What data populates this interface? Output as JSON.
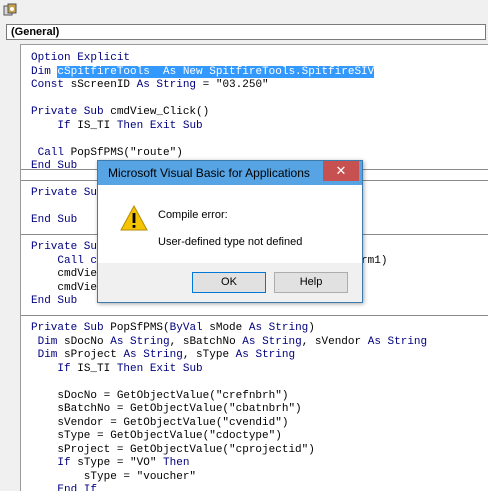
{
  "object_combo": {
    "value": "(General)"
  },
  "code": [
    [
      {
        "t": "Option Explicit",
        "c": "kw"
      }
    ],
    [
      {
        "t": "Dim ",
        "c": "kw"
      },
      {
        "t": "cSpitfireTools  As New SpitfireTools.SpitfireSIV",
        "c": "sel"
      }
    ],
    [
      {
        "t": "Const ",
        "c": "kw"
      },
      {
        "t": "sScreenID "
      },
      {
        "t": "As String",
        "c": "kw"
      },
      {
        "t": " = \"03.250\""
      }
    ],
    [],
    [
      {
        "t": "Private Sub ",
        "c": "kw"
      },
      {
        "t": "cmdView_Click()"
      }
    ],
    [
      {
        "t": "    If ",
        "c": "kw"
      },
      {
        "t": "IS_TI "
      },
      {
        "t": "Then Exit Sub",
        "c": "kw"
      }
    ],
    [],
    [
      {
        "t": " Call ",
        "c": "kw"
      },
      {
        "t": "PopSfPMS(\"route\")"
      }
    ],
    [
      {
        "t": "End Sub",
        "c": "kw"
      }
    ],
    [],
    [
      {
        "t": "Private Su",
        "c": "kw"
      }
    ],
    [],
    [
      {
        "t": "End Sub",
        "c": "kw"
      }
    ],
    [],
    [
      {
        "t": "Private Su",
        "c": "kw"
      }
    ],
    [
      {
        "t": "    Call c",
        "c": "kw"
      },
      {
        "t": "                           ThisScreen.Form1)"
      }
    ],
    [
      {
        "t": "    cmdVie"
      }
    ],
    [
      {
        "t": "    cmdVie"
      }
    ],
    [
      {
        "t": "End Sub",
        "c": "kw"
      }
    ],
    [],
    [
      {
        "t": "Private Sub ",
        "c": "kw"
      },
      {
        "t": "PopSfPMS("
      },
      {
        "t": "ByVal ",
        "c": "kw"
      },
      {
        "t": "sMode "
      },
      {
        "t": "As String",
        "c": "kw"
      },
      {
        "t": ")"
      }
    ],
    [
      {
        "t": " Dim ",
        "c": "kw"
      },
      {
        "t": "sDocNo "
      },
      {
        "t": "As String",
        "c": "kw"
      },
      {
        "t": ", sBatchNo "
      },
      {
        "t": "As String",
        "c": "kw"
      },
      {
        "t": ", sVendor "
      },
      {
        "t": "As String",
        "c": "kw"
      }
    ],
    [
      {
        "t": " Dim ",
        "c": "kw"
      },
      {
        "t": "sProject "
      },
      {
        "t": "As String",
        "c": "kw"
      },
      {
        "t": ", sType "
      },
      {
        "t": "As String",
        "c": "kw"
      }
    ],
    [
      {
        "t": "    If ",
        "c": "kw"
      },
      {
        "t": "IS_TI "
      },
      {
        "t": "Then Exit Sub",
        "c": "kw"
      }
    ],
    [],
    [
      {
        "t": "    sDocNo = GetObjectValue(\"crefnbrh\")"
      }
    ],
    [
      {
        "t": "    sBatchNo = GetObjectValue(\"cbatnbrh\")"
      }
    ],
    [
      {
        "t": "    sVendor = GetObjectValue(\"cvendid\")"
      }
    ],
    [
      {
        "t": "    sType = GetObjectValue(\"cdoctype\")"
      }
    ],
    [
      {
        "t": "    sProject = GetObjectValue(\"cprojectid\")"
      }
    ],
    [
      {
        "t": "    If ",
        "c": "kw"
      },
      {
        "t": "sType = \"VO\" "
      },
      {
        "t": "Then",
        "c": "kw"
      }
    ],
    [
      {
        "t": "        sType = \"voucher\""
      }
    ],
    [
      {
        "t": "    End If",
        "c": "kw"
      }
    ]
  ],
  "dialog": {
    "title": "Microsoft Visual Basic for Applications",
    "close_glyph": "✕",
    "message_line1": "Compile error:",
    "message_line2": "User-defined type not defined",
    "ok_label": "OK",
    "help_label": "Help"
  }
}
